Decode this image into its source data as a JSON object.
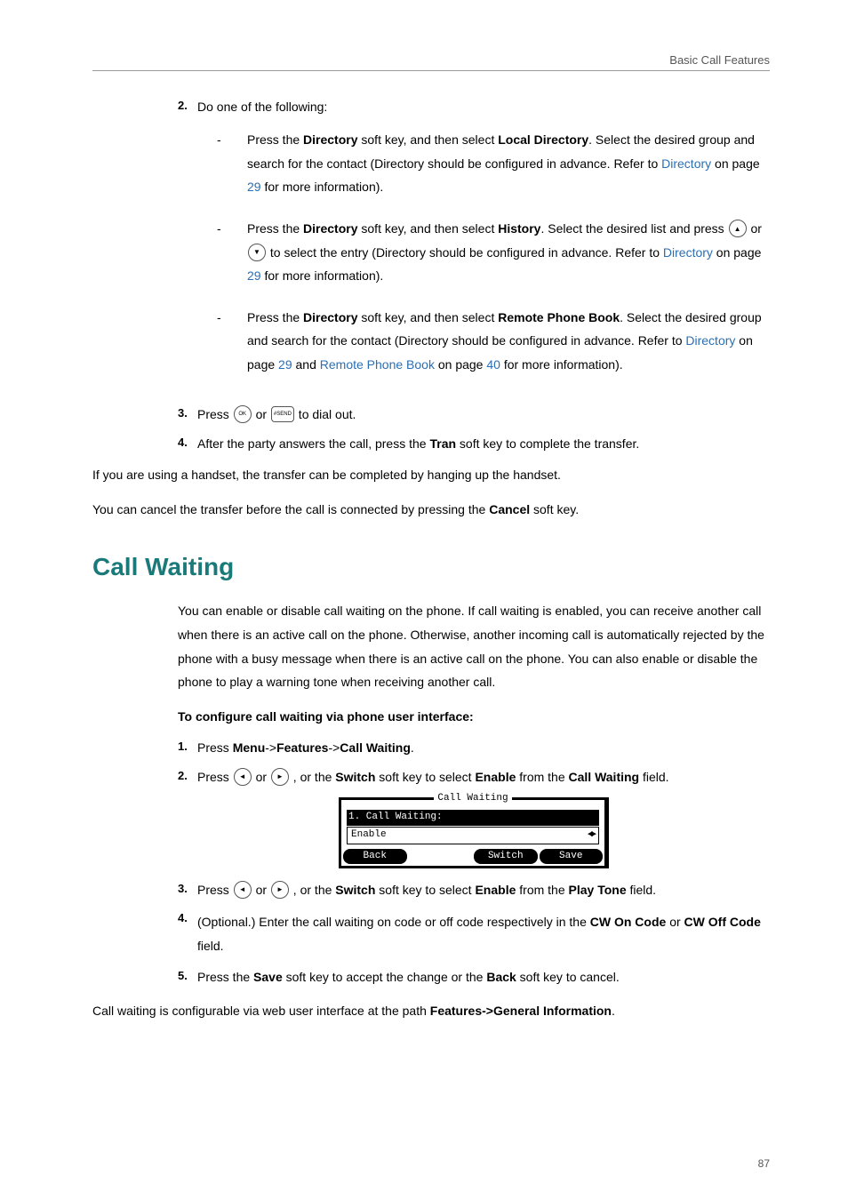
{
  "header": "Basic Call Features",
  "page_num": "87",
  "step2": {
    "num": "2.",
    "text": "Do one of the following:",
    "dash": "-",
    "b1_part1": "Press the ",
    "b1_dir": "Directory",
    "b1_part2": " soft key, and then select ",
    "b1_local": "Local Directory",
    "b1_part3": ". Select the desired group and search for the contact (Directory should be configured in advance. Refer to ",
    "b1_link": "Directory",
    "b1_part4": " on page ",
    "b1_page": "29",
    "b1_part5": " for more information).",
    "b2_part1": "Press the ",
    "b2_dir": "Directory",
    "b2_part2": " soft key, and then select ",
    "b2_hist": "History",
    "b2_part3": ". Select the desired list and press ",
    "b2_or": " or ",
    "b2_part4": " to select the entry (Directory should be configured in advance. Refer to ",
    "b2_link": "Directory",
    "b2_part5": " on page ",
    "b2_page": "29",
    "b2_part6": " for more information).",
    "b3_part1": "Press the ",
    "b3_dir": "Directory",
    "b3_part2": " soft key, and then select ",
    "b3_remote": "Remote Phone Book",
    "b3_part3": ". Select the desired group and search for the contact (Directory should be configured in advance. Refer to ",
    "b3_link1": "Directory",
    "b3_part4": " on page ",
    "b3_page1": "29",
    "b3_part5": " and ",
    "b3_link2": "Remote Phone Book",
    "b3_part6": " on page ",
    "b3_page2": "40",
    "b3_part7": " for more information)."
  },
  "step3": {
    "num": "3.",
    "t1": "Press ",
    "ok": "OK",
    "or": " or ",
    "hash": "#SEND",
    "t2": " to dial out."
  },
  "step4": {
    "num": "4.",
    "t1": "After the party answers the call, press the ",
    "tran": "Tran",
    "t2": " soft key to complete the transfer."
  },
  "after1": "If you are using a handset, the transfer can be completed by hanging up the handset.",
  "after2_t1": "You can cancel the transfer before the call is connected by pressing the ",
  "after2_cancel": "Cancel",
  "after2_t2": " soft key.",
  "cw_title": "Call Waiting",
  "cw_para": "You can enable or disable call waiting on the phone. If call waiting is enabled, you can receive another call when there is an active call on the phone. Otherwise, another incoming call is automatically rejected by the phone with a busy message when there is an active call on the phone. You can also enable or disable the phone to play a warning tone when receiving another call.",
  "cw_config": "To configure call waiting via phone user interface:",
  "cw1": {
    "num": "1.",
    "t1": "Press ",
    "menu": "Menu",
    "arrow": "->",
    "feat": "Features",
    "cw": "Call Waiting",
    "dot": "."
  },
  "cw2": {
    "num": "2.",
    "t1": "Press ",
    "or": " or ",
    "t2": " , or the ",
    "switch": "Switch",
    "t3": " soft key to select ",
    "enable": "Enable",
    "t4": " from the ",
    "field": "Call Waiting",
    "t5": " field."
  },
  "figure": {
    "title": "Call Waiting",
    "row": "1. Call Waiting:",
    "value": "Enable",
    "back": "Back",
    "switch": "Switch",
    "save": "Save"
  },
  "cw3": {
    "num": "3.",
    "t1": "Press ",
    "or": " or ",
    "t2": " , or the ",
    "switch": "Switch",
    "t3": " soft key to select ",
    "enable": "Enable",
    "t4": " from the ",
    "field": "Play Tone",
    "t5": " field."
  },
  "cw4": {
    "num": "4.",
    "t1": "(Optional.) Enter the call waiting on code or off code respectively in the ",
    "on": "CW On Code",
    "or": " or ",
    "off": "CW Off Code",
    "t2": " field."
  },
  "cw5": {
    "num": "5.",
    "t1": "Press the ",
    "save": "Save",
    "t2": " soft key to accept the change or the ",
    "back": "Back",
    "t3": " soft key to cancel."
  },
  "cw_footer_t1": "Call waiting is configurable via web user interface at the path ",
  "cw_footer_path": "Features->General Information",
  "cw_footer_t2": "."
}
